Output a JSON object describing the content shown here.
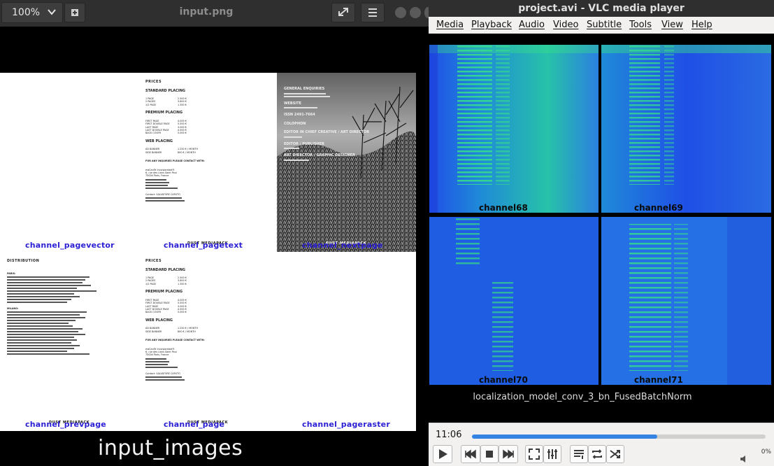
{
  "viewer": {
    "zoom": "100%",
    "title": "input.png"
  },
  "canvas": {
    "doc": {
      "prices_heading": "PRICES",
      "standard_placing": "STANDARD PLACING",
      "premium_placing": "PREMIUM PLACING",
      "web_placing": "WEB PLACING",
      "distribution_heading": "DISTRIBUTION",
      "general_enquiries": "GENERAL ENQUIRIES",
      "website": "WEBSITE",
      "issn": "ISSN 2491-7664",
      "colophon": "COLOPHON",
      "editor_in_chief": "EDITOR IN CHIEF CREATIVE / ART DIRECTOR",
      "editor_publisher": "EDITOR / PUBLISHER",
      "art_director": "ART DIRECTOR / GRAPHIC DESIGNER",
      "standard_rows": [
        [
          "1 PAGE",
          "2.500 €"
        ],
        [
          "2 PAGES",
          "3.800 €"
        ],
        [
          "1/2 PAGE",
          "1.350 €"
        ]
      ],
      "premium_rows": [
        [
          "FIRST PAGE",
          "4.000 €"
        ],
        [
          "FIRST DOUBLE PAGE",
          "5.500 €"
        ],
        [
          "LAST PAGE",
          "3.000 €"
        ],
        [
          "LAST DOUBLE PAGE",
          "4.500 €"
        ],
        [
          "BACK COVER",
          "5.000 €"
        ]
      ],
      "web_rows": [
        [
          "AD BANNER",
          "1.250 € / MONTH"
        ],
        [
          "SIDE BANNER",
          "800 € / MONTH"
        ]
      ],
      "contact_line": "FOR ANY INQUIRIES PLEASE CONTACT WITH:",
      "company": "estCanTa Incorporated®",
      "address": "6, rue des Lions Saint Paul",
      "city": "75004 Paris, France",
      "contact_name": "Contact: SALVATORE CAPUTO",
      "footer_brand": "DUST MEDIAPACK",
      "paris_label": "PARIS:",
      "milan_label": "MILANO:"
    },
    "captions": {
      "pagevector": "channel_pagevector",
      "pagetext": "channel_pagetext",
      "nextpage": "channel_nextpage",
      "prevpage": "channel_prevpage",
      "page": "channel_page",
      "pageraster": "channel_pageraster"
    },
    "bottom_caption": "input_images"
  },
  "vlc": {
    "title": "project.avi - VLC media player",
    "menu": [
      "Media",
      "Playback",
      "Audio",
      "Video",
      "Subtitle",
      "Tools",
      "View",
      "Help"
    ],
    "tiles": [
      "channel68",
      "channel69",
      "channel70",
      "channel71"
    ],
    "video_caption": "localization_model_conv_3_bn_FusedBatchNorm",
    "time": "11:06",
    "progress": 0.63,
    "volume": "0%"
  },
  "colors": {
    "caption_blue": "#2a1fd4",
    "seek_blue": "#3584e4",
    "tile_blue": "#1f4fe6",
    "tile_green": "#36e08a"
  }
}
